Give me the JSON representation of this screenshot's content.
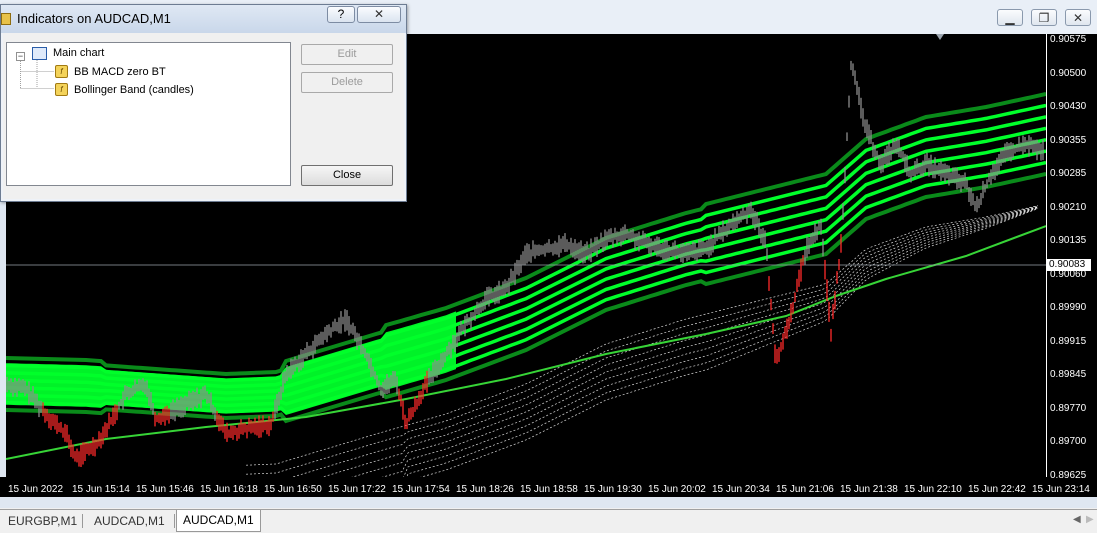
{
  "dialog": {
    "title": "Indicators on AUDCAD,M1",
    "help_label": "?",
    "tree": {
      "root": "Main chart",
      "children": [
        "BB MACD zero BT",
        "Bollinger Band (candles)"
      ]
    },
    "edit_label": "Edit",
    "delete_label": "Delete",
    "close_label": "Close"
  },
  "chart": {
    "symbol": "AUDCAD,M1",
    "current_price": "0.90083",
    "price_labels": [
      "0.90575",
      "0.90500",
      "0.90430",
      "0.90355",
      "0.90285",
      "0.90210",
      "0.90135",
      "0.90060",
      "0.89990",
      "0.89915",
      "0.89845",
      "0.89770",
      "0.89700",
      "0.89625"
    ],
    "time_labels": [
      "15 Jun 2022",
      "15 Jun 15:14",
      "15 Jun 15:46",
      "15 Jun 16:18",
      "15 Jun 16:50",
      "15 Jun 17:22",
      "15 Jun 17:54",
      "15 Jun 18:26",
      "15 Jun 18:58",
      "15 Jun 19:30",
      "15 Jun 20:02",
      "15 Jun 20:34",
      "15 Jun 21:06",
      "15 Jun 21:38",
      "15 Jun 22:10",
      "15 Jun 22:42",
      "15 Jun 23:14"
    ],
    "colors": {
      "background": "#000000",
      "band_fill": "#00ff2a",
      "band_dark": "#0a8a1a",
      "ma_line": "#37d437",
      "candle": "#8c8c8c",
      "bear_candle": "#ff2a2a",
      "dots": "#ffffff"
    }
  },
  "tabs": [
    {
      "label": "EURGBP,M1",
      "active": false
    },
    {
      "label": "AUDCAD,M1",
      "active": false
    },
    {
      "label": "AUDCAD,M1",
      "active": true
    }
  ]
}
